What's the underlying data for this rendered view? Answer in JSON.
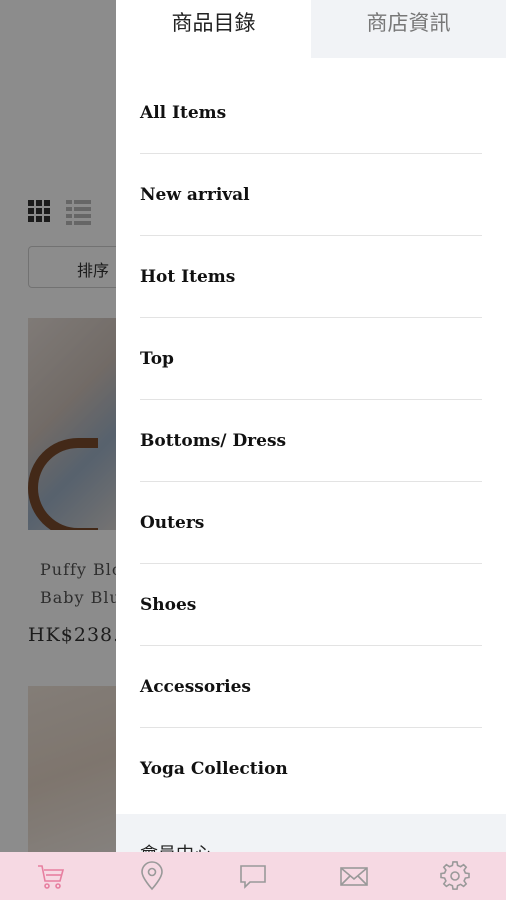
{
  "background_page": {
    "sort_label": "排序",
    "product_name_line1": "Puffy Blo",
    "product_name_line2": "Baby Blu",
    "product_price": "HK$238."
  },
  "drawer": {
    "tabs": [
      {
        "label": "商品目錄",
        "active": true
      },
      {
        "label": "商店資訊",
        "active": false
      }
    ],
    "categories": [
      "All Items",
      "New arrival",
      "Hot Items",
      "Top",
      "Bottoms/ Dress",
      "Outers",
      "Shoes",
      "Accessories",
      "Yoga Collection"
    ],
    "member_section_label": "會員中心"
  },
  "bottom_nav": {
    "background_color": "#f6d9e3",
    "items": [
      {
        "icon": "cart-icon",
        "active": true,
        "color": "#e77fa0"
      },
      {
        "icon": "location-pin-icon",
        "active": false,
        "color": "#999999"
      },
      {
        "icon": "chat-bubble-icon",
        "active": false,
        "color": "#999999"
      },
      {
        "icon": "mail-icon",
        "active": false,
        "color": "#999999"
      },
      {
        "icon": "gear-icon",
        "active": false,
        "color": "#999999"
      }
    ]
  }
}
